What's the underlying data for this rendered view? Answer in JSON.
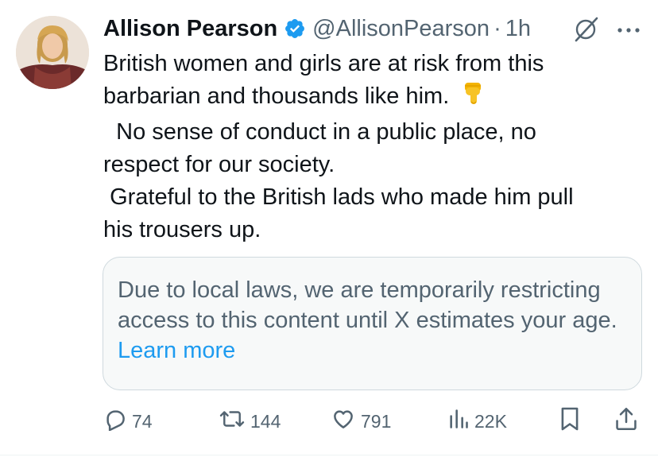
{
  "tweet": {
    "author_name": "Allison Pearson",
    "handle": "@AllisonPearson",
    "separator": "·",
    "time": "1h",
    "body_lines": [
      "British women and girls are at risk from this",
      "barbarian and thousands like him.",
      "  No sense of conduct in a public place, no",
      "respect for our society.",
      " Grateful to the British lads who made him pull",
      "his trousers up."
    ],
    "emoji": "backhand-index-pointing-down",
    "notice": {
      "text": "Due to local laws, we are temporarily restricting access to this content until X estimates your age.",
      "link": "Learn more"
    },
    "actions": {
      "replies": "74",
      "reposts": "144",
      "likes": "791",
      "views": "22K"
    }
  },
  "colors": {
    "text": "#0f1419",
    "secondary": "#536471",
    "accent": "#1d9bf0",
    "border": "#cfd9de",
    "notice_bg": "#f7f9f9"
  },
  "icons": {
    "verified": "verified-badge-icon",
    "grok": "grok-icon",
    "more": "more-icon",
    "reply": "reply-icon",
    "repost": "repost-icon",
    "like": "like-icon",
    "views": "views-icon",
    "bookmark": "bookmark-icon",
    "share": "share-icon"
  }
}
